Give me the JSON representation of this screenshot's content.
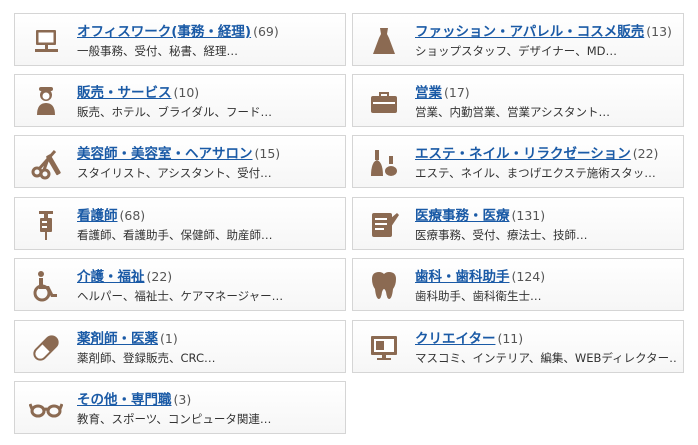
{
  "accent_color": "#1a5aa6",
  "icon_color": "#8b6a52",
  "categories": [
    {
      "title": "オフィスワーク(事務・経理)",
      "count": "(69)",
      "sub": "一般事務、受付、秘書、経理…",
      "icon": "computer-icon"
    },
    {
      "title": "ファッション・アパレル・コスメ販売",
      "count": "(13)",
      "sub": "ショップスタッフ、デザイナー、MD…",
      "icon": "dress-icon"
    },
    {
      "title": "販売・サービス",
      "count": "(10)",
      "sub": "販売、ホテル、ブライダル、フード…",
      "icon": "clerk-icon"
    },
    {
      "title": "営業",
      "count": "(17)",
      "sub": "営業、内勤営業、営業アシスタント…",
      "icon": "briefcase-icon"
    },
    {
      "title": "美容師・美容室・ヘアサロン",
      "count": "(15)",
      "sub": "スタイリスト、アシスタント、受付…",
      "icon": "scissors-comb-icon"
    },
    {
      "title": "エステ・ネイル・リラクゼーション",
      "count": "(22)",
      "sub": "エステ、ネイル、まつげエクステ施術スタッ…",
      "icon": "bottles-icon"
    },
    {
      "title": "看護師",
      "count": "(68)",
      "sub": "看護師、看護助手、保健師、助産師…",
      "icon": "syringe-icon"
    },
    {
      "title": "医療事務・医療",
      "count": "(131)",
      "sub": "医療事務、受付、療法士、技師…",
      "icon": "medical-form-icon"
    },
    {
      "title": "介護・福祉",
      "count": "(22)",
      "sub": "ヘルパー、福祉士、ケアマネージャー…",
      "icon": "wheelchair-icon"
    },
    {
      "title": "歯科・歯科助手",
      "count": "(124)",
      "sub": "歯科助手、歯科衛生士…",
      "icon": "tooth-icon"
    },
    {
      "title": "薬剤師・医薬",
      "count": "(1)",
      "sub": "薬剤師、登録販売、CRC…",
      "icon": "capsule-icon"
    },
    {
      "title": "クリエイター",
      "count": "(11)",
      "sub": "マスコミ、インテリア、編集、WEBディレクター…",
      "icon": "monitor-icon"
    },
    {
      "title": "その他・専門職",
      "count": "(3)",
      "sub": "教育、スポーツ、コンピュータ関連…",
      "icon": "glasses-icon"
    }
  ]
}
